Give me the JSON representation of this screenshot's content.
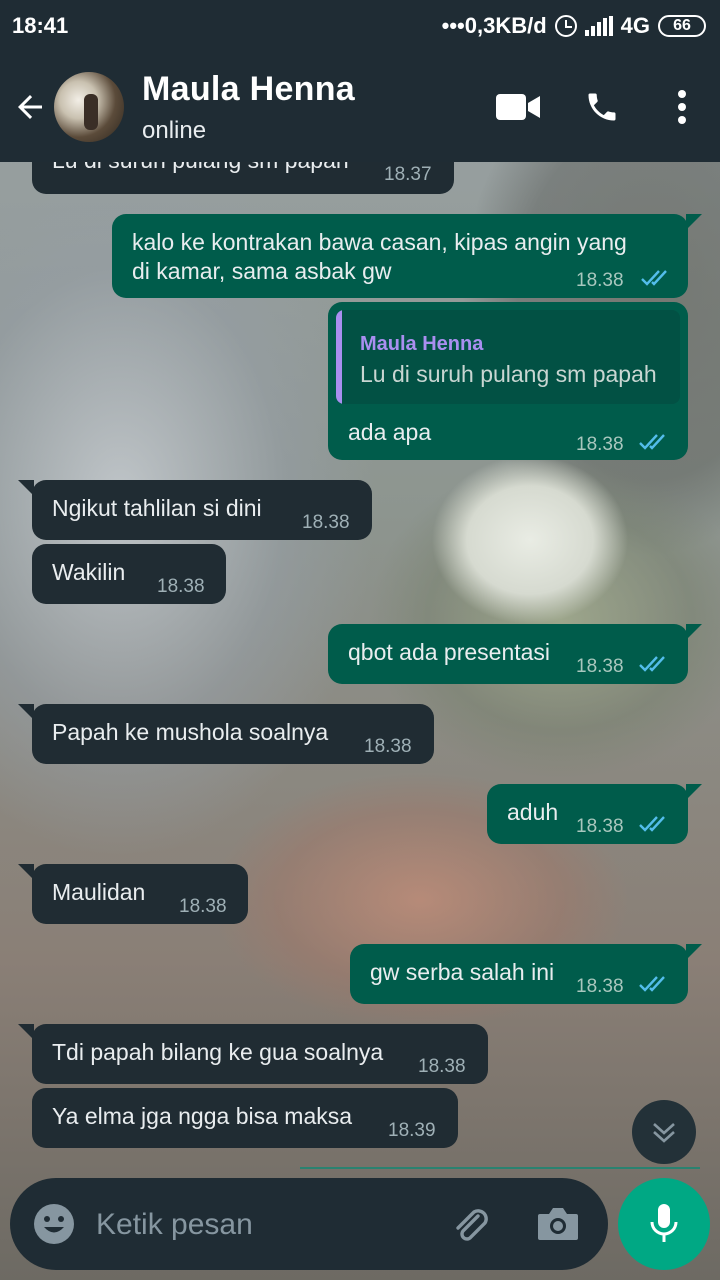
{
  "status_bar": {
    "time": "18:41",
    "net_speed": "•••0,3KB/d",
    "network": "4G",
    "battery": "66"
  },
  "header": {
    "contact_name": "Maula Henna",
    "presence": "online"
  },
  "messages": [
    {
      "direction": "in",
      "text": "Lu di suruh pulang sm papah",
      "time": "18.37"
    },
    {
      "direction": "out",
      "text_line1": "kalo ke kontrakan bawa casan, kipas angin yang",
      "text_line2": "di kamar, sama asbak gw",
      "time": "18.38",
      "status": "read"
    },
    {
      "direction": "out",
      "quote_author": "Maula Henna",
      "quote_text": "Lu di suruh pulang sm papah",
      "text": "ada apa",
      "time": "18.38",
      "status": "read"
    },
    {
      "direction": "in",
      "text": "Ngikut tahlilan si dini",
      "time": "18.38"
    },
    {
      "direction": "in",
      "text": "Wakilin",
      "time": "18.38"
    },
    {
      "direction": "out",
      "text": "qbot ada presentasi",
      "time": "18.38",
      "status": "read"
    },
    {
      "direction": "in",
      "text": "Papah ke mushola soalnya",
      "time": "18.38"
    },
    {
      "direction": "out",
      "text": "aduh",
      "time": "18.38",
      "status": "read"
    },
    {
      "direction": "in",
      "text": "Maulidan",
      "time": "18.38"
    },
    {
      "direction": "out",
      "text": "gw serba salah ini",
      "time": "18.38",
      "status": "read"
    },
    {
      "direction": "in",
      "text": "Tdi papah bilang ke gua soalnya",
      "time": "18.38"
    },
    {
      "direction": "in",
      "text": "Ya elma jga ngga bisa maksa",
      "time": "18.39"
    }
  ],
  "input": {
    "placeholder": "Ketik pesan"
  },
  "icons": {
    "back": "arrow-left-icon",
    "video": "video-call-icon",
    "voice": "phone-icon",
    "menu": "more-vert-icon",
    "emoji": "emoji-icon",
    "attach": "paperclip-icon",
    "camera": "camera-icon",
    "mic": "mic-icon",
    "scroll": "chevron-down-double-icon"
  },
  "colors": {
    "header_bg": "#1f2c34",
    "incoming_bubble": "#202c33",
    "outgoing_bubble": "#005c4b",
    "read_ticks": "#53bdeb",
    "accent": "#00a884",
    "quote_author": "#a98ff0"
  }
}
